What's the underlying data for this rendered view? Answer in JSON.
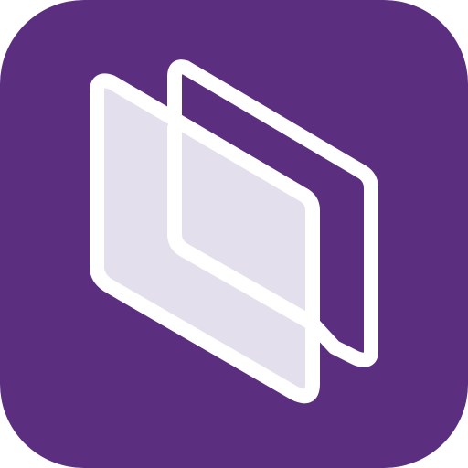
{
  "icon": {
    "name": "layered-panels-app-icon",
    "colors": {
      "background": "#5B2E7F",
      "stroke": "#FFFFFF",
      "front_panel_fill": "#E4DFEC"
    }
  }
}
